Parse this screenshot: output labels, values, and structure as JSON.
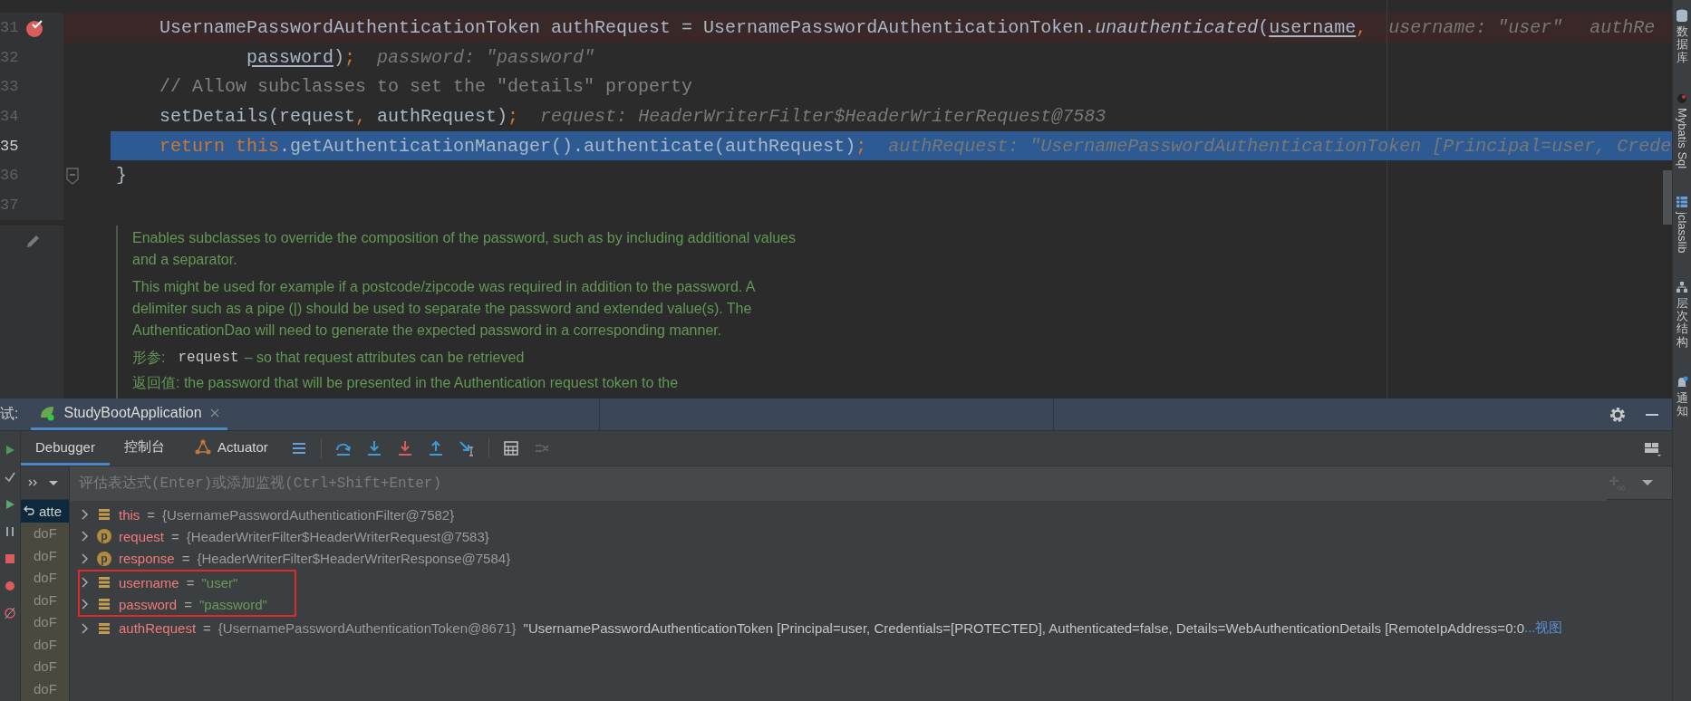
{
  "editor": {
    "lines": [
      {
        "number": "31",
        "kind": "statement",
        "current": false,
        "breakpoint": true,
        "fold": false,
        "tokens": [
          {
            "text": "UsernamePasswordAuthenticationToken authRequest = UsernamePasswordAuthenticationToken.",
            "kind": "plain"
          },
          {
            "text": "unauthenticated",
            "kind": "italic"
          },
          {
            "text": "(",
            "kind": "plain"
          },
          {
            "text": "username",
            "kind": "var"
          },
          {
            "text": ",",
            "kind": "keyword"
          }
        ],
        "hints": [
          "username: \"user\"",
          "authRe"
        ]
      },
      {
        "number": "32",
        "kind": "continuation",
        "current": false,
        "breakpoint": false,
        "fold": false,
        "tokens": [
          {
            "text": "password",
            "kind": "var"
          },
          {
            "text": ")",
            "kind": "plain"
          },
          {
            "text": ";",
            "kind": "keyword"
          }
        ],
        "hints": [
          "password: \"password\""
        ]
      },
      {
        "number": "33",
        "kind": "statement",
        "current": false,
        "breakpoint": false,
        "fold": false,
        "tokens": [
          {
            "text": "// Allow subclasses to set the \"details\" property",
            "kind": "comment"
          }
        ]
      },
      {
        "number": "34",
        "kind": "statement",
        "current": false,
        "breakpoint": false,
        "fold": false,
        "tokens": [
          {
            "text": "setDetails(request",
            "kind": "plain"
          },
          {
            "text": ",",
            "kind": "keyword"
          },
          {
            "text": " authRequest)",
            "kind": "plain"
          },
          {
            "text": ";",
            "kind": "keyword"
          }
        ],
        "hints": [
          "request: HeaderWriterFilter$HeaderWriterRequest@7583"
        ]
      },
      {
        "number": "35",
        "kind": "statement",
        "current": true,
        "breakpoint": false,
        "fold": false,
        "tokens": [
          {
            "text": "return this",
            "kind": "keyword"
          },
          {
            "text": ".getAuthenticationManager().authenticate(authRequest)",
            "kind": "plain"
          },
          {
            "text": ";",
            "kind": "keyword"
          }
        ],
        "hints": [
          "authRequest: \"UsernamePasswordAuthenticationToken [Principal=user, Crede"
        ]
      },
      {
        "number": "36",
        "kind": "brace",
        "current": false,
        "breakpoint": false,
        "fold": true,
        "tokens": [
          {
            "text": "}",
            "kind": "plain"
          }
        ]
      },
      {
        "number": "37",
        "kind": "empty",
        "current": false,
        "breakpoint": false,
        "fold": false
      }
    ],
    "doc": {
      "paragraphs": [
        "Enables subclasses to override the composition of the password, such as by including additional values and a separator.",
        "This might be used for example if a postcode/zipcode was required in addition to the password. A delimiter such as a pipe (|) should be used to separate the password and extended value(s). The AuthenticationDao will need to generate the expected password in a corresponding manner."
      ],
      "param": {
        "label": "形参:",
        "name": "request",
        "text": "– so that request attributes can be retrieved"
      },
      "returns": "返回值: the password that will be presented in the Authentication request token to the"
    }
  },
  "debugger": {
    "title": "试:",
    "session_tab": {
      "label": "StudyBootApplication",
      "selected": true
    },
    "tabs": [
      {
        "label": "Debugger",
        "selected": true
      },
      {
        "label": "控制台",
        "selected": false
      },
      {
        "label": "Actuator",
        "selected": false
      }
    ],
    "watch": {
      "placeholder": "评估表达式(Enter)或添加监视(Ctrl+Shift+Enter)"
    },
    "frames": [
      {
        "label": "atte",
        "selected": true
      },
      {
        "label": "doF",
        "selected": false
      },
      {
        "label": "doF",
        "selected": false
      },
      {
        "label": "doF",
        "selected": false
      },
      {
        "label": "doF",
        "selected": false
      },
      {
        "label": "doF",
        "selected": false
      },
      {
        "label": "doF",
        "selected": false
      },
      {
        "label": "doF",
        "selected": false
      },
      {
        "label": "doF",
        "selected": false
      }
    ],
    "variables": [
      {
        "name": "this",
        "kind": "field",
        "operator": "=",
        "value": "{UsernamePasswordAuthenticationFilter@7582}",
        "string_value": false,
        "highlighted": false
      },
      {
        "name": "request",
        "kind": "param",
        "badge": "p",
        "operator": "=",
        "value": "{HeaderWriterFilter$HeaderWriterRequest@7583}",
        "string_value": false,
        "highlighted": false
      },
      {
        "name": "response",
        "kind": "param",
        "badge": "p",
        "operator": "=",
        "value": "{HeaderWriterFilter$HeaderWriterResponse@7584}",
        "string_value": false,
        "highlighted": false
      },
      {
        "name": "username",
        "kind": "field",
        "operator": "=",
        "value": "\"user\"",
        "string_value": true,
        "highlighted": true
      },
      {
        "name": "password",
        "kind": "field",
        "operator": "=",
        "value": "\"password\"",
        "string_value": true,
        "highlighted": true
      },
      {
        "name": "authRequest",
        "kind": "field",
        "operator": "=",
        "value": "{UsernamePasswordAuthenticationToken@8671}",
        "string_value": false,
        "description": "\"UsernamePasswordAuthenticationToken [Principal=user, Credentials=[PROTECTED], Authenticated=false, Details=WebAuthenticationDetails [RemoteIpAddress=0:0",
        "link": "...视图",
        "highlighted": false
      }
    ]
  },
  "tool_stripe": [
    {
      "label": "数据库",
      "kind": "cjk"
    },
    {
      "label": "Mybatis Sql",
      "kind": "latin"
    },
    {
      "label": "jclasslib",
      "kind": "latin"
    },
    {
      "label": "层次结构",
      "kind": "cjk"
    },
    {
      "label": "通知",
      "kind": "cjk"
    }
  ]
}
